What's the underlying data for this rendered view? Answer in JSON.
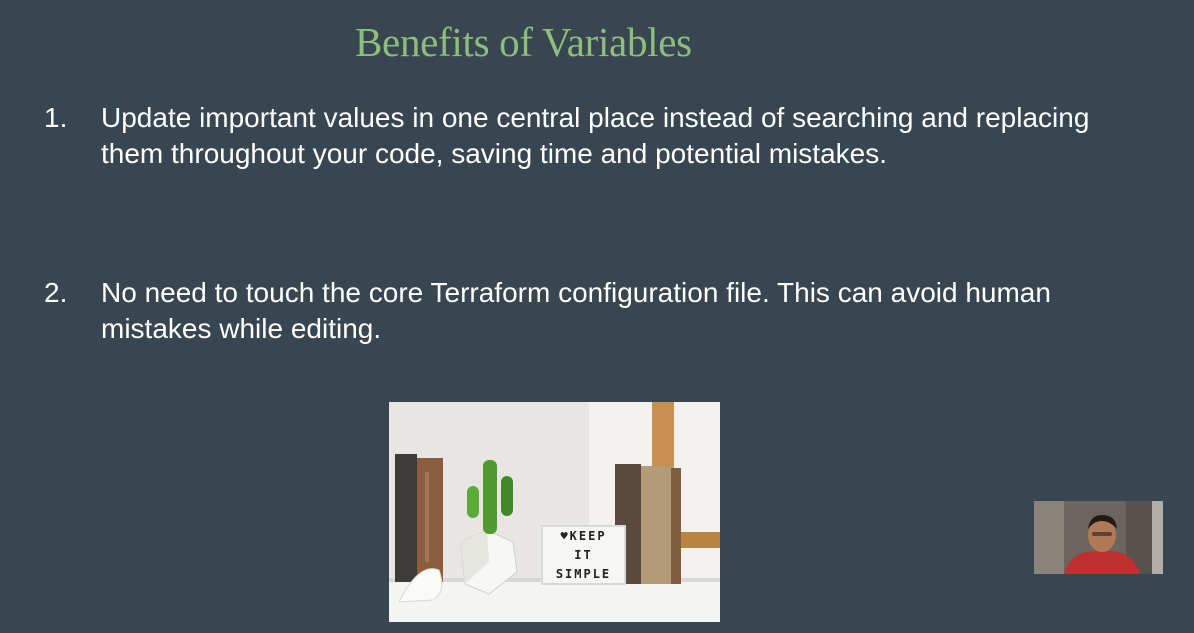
{
  "slide": {
    "title": "Benefits of Variables",
    "items": [
      {
        "number": "1.",
        "text": "Update important values in one central place instead of searching and replacing them throughout your code, saving time and potential mistakes."
      },
      {
        "number": "2.",
        "text": "No need to touch the core Terraform configuration file. This can avoid human mistakes while editing."
      }
    ],
    "image": {
      "lightbox_lines": [
        "♥KEEP",
        "IT",
        "SIMPLE"
      ]
    }
  },
  "colors": {
    "background": "#374650",
    "title": "#8fbd7e",
    "text": "#ffffff"
  }
}
